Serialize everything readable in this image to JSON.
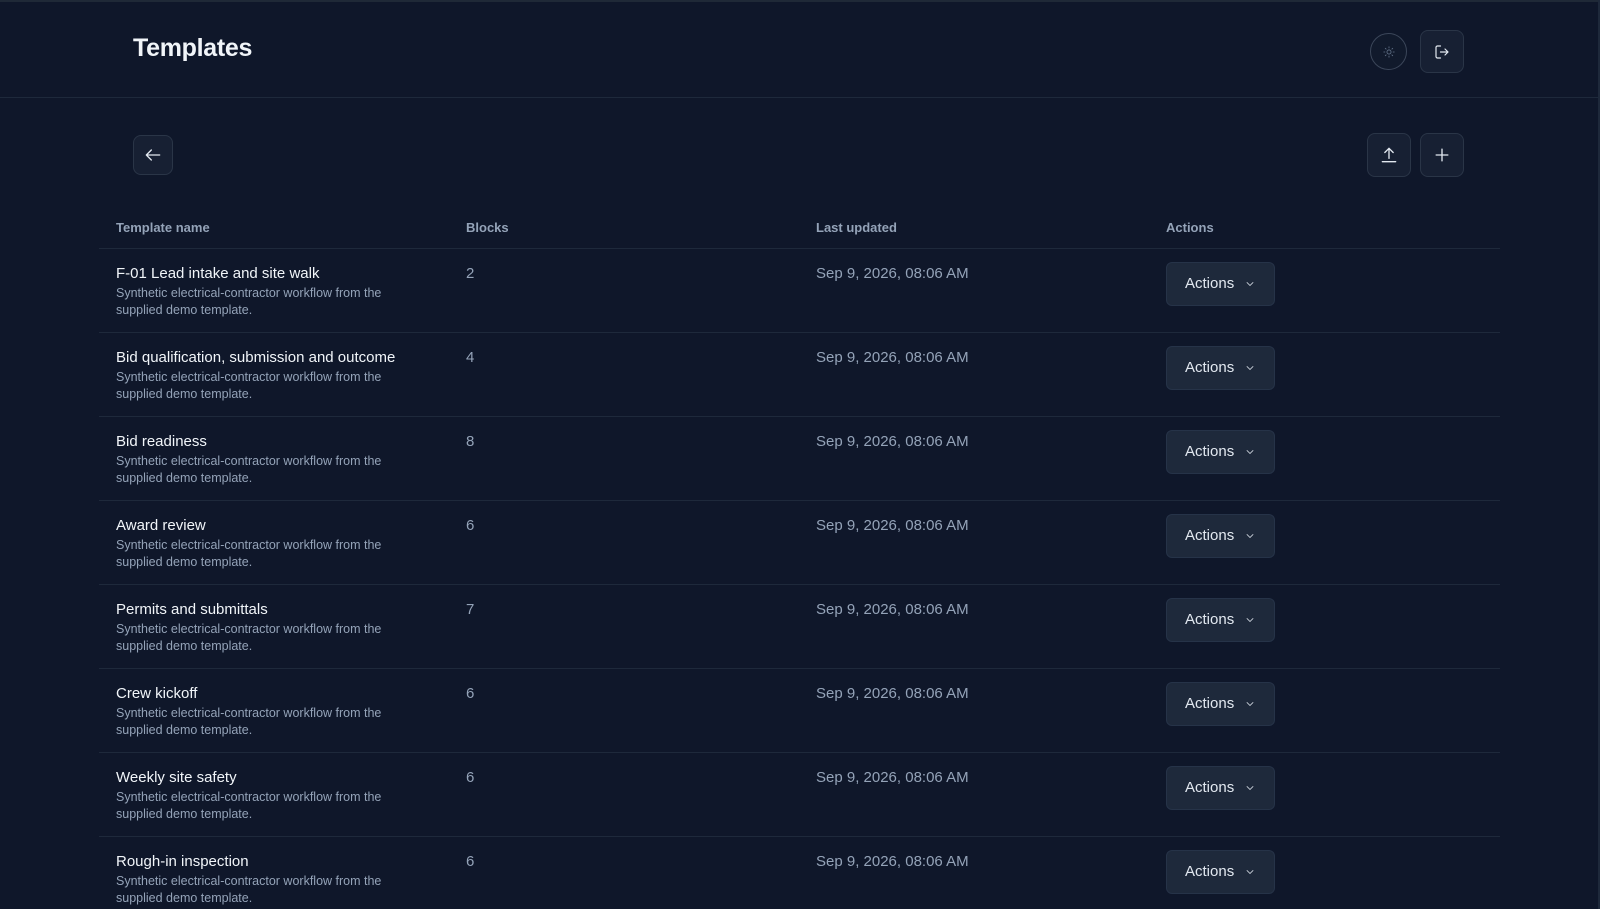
{
  "header": {
    "title": "Templates"
  },
  "icons": {
    "theme": "sun-icon",
    "logout": "logout-icon",
    "back": "arrow-left-icon",
    "upload": "upload-icon",
    "add": "plus-icon",
    "dropdown": "chevron-down-icon"
  },
  "colors": {
    "background": "#0f172a",
    "button": "#1e293b",
    "muted_text": "#94a3b8"
  },
  "table": {
    "columns": [
      "Template name",
      "Blocks",
      "Last updated",
      "Actions"
    ],
    "rows": [
      {
        "name": "F-01 Lead intake and site walk",
        "description": "Synthetic electrical-contractor workflow from the supplied demo template.",
        "blocks": "2",
        "updated": "Sep 9, 2026, 08:06 AM",
        "action_label": "Actions"
      },
      {
        "name": "Bid qualification, submission and outcome",
        "description": "Synthetic electrical-contractor workflow from the supplied demo template.",
        "blocks": "4",
        "updated": "Sep 9, 2026, 08:06 AM",
        "action_label": "Actions"
      },
      {
        "name": "Bid readiness",
        "description": "Synthetic electrical-contractor workflow from the supplied demo template.",
        "blocks": "8",
        "updated": "Sep 9, 2026, 08:06 AM",
        "action_label": "Actions"
      },
      {
        "name": "Award review",
        "description": "Synthetic electrical-contractor workflow from the supplied demo template.",
        "blocks": "6",
        "updated": "Sep 9, 2026, 08:06 AM",
        "action_label": "Actions"
      },
      {
        "name": "Permits and submittals",
        "description": "Synthetic electrical-contractor workflow from the supplied demo template.",
        "blocks": "7",
        "updated": "Sep 9, 2026, 08:06 AM",
        "action_label": "Actions"
      },
      {
        "name": "Crew kickoff",
        "description": "Synthetic electrical-contractor workflow from the supplied demo template.",
        "blocks": "6",
        "updated": "Sep 9, 2026, 08:06 AM",
        "action_label": "Actions"
      },
      {
        "name": "Weekly site safety",
        "description": "Synthetic electrical-contractor workflow from the supplied demo template.",
        "blocks": "6",
        "updated": "Sep 9, 2026, 08:06 AM",
        "action_label": "Actions"
      },
      {
        "name": "Rough-in inspection",
        "description": "Synthetic electrical-contractor workflow from the supplied demo template.",
        "blocks": "6",
        "updated": "Sep 9, 2026, 08:06 AM",
        "action_label": "Actions"
      }
    ]
  }
}
